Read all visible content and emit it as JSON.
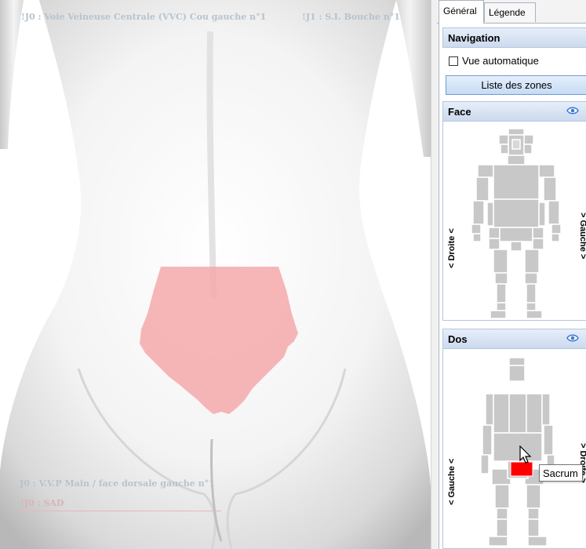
{
  "viewer": {
    "label_top_left": "!J0 : Voie Veineuse Centrale (VVC) Cou gauche n°1",
    "label_top_right": "!J1 : S.I. Bouche n°1",
    "label_bottom_1": "J0 : V.V.P Main / face dorsale gauche n°1",
    "label_bottom_2": "!J0 : SAD",
    "highlight_zone_color": "#f4a9ab"
  },
  "tabs": [
    {
      "label": "Général",
      "active": true
    },
    {
      "label": "Légende",
      "active": false
    }
  ],
  "navigation": {
    "header": "Navigation",
    "auto_view_label": "Vue automatique",
    "auto_view_checked": false,
    "zones_button": "Liste des zones"
  },
  "face": {
    "header": "Face",
    "left_side_label": "< Droite <",
    "right_side_label": "> Gauche >"
  },
  "dos": {
    "header": "Dos",
    "left_side_label": "< Gauche <",
    "right_side_label": "> Droite >",
    "selected_zone": "Sacrum",
    "selected_color": "#ff0000"
  },
  "tooltip": "Sacrum",
  "colors": {
    "zone_gray": "#c8c8c8",
    "header_gradient": "#ccdaee",
    "button_border": "#6f9bd3",
    "eye_icon": "#3a7bd5"
  }
}
